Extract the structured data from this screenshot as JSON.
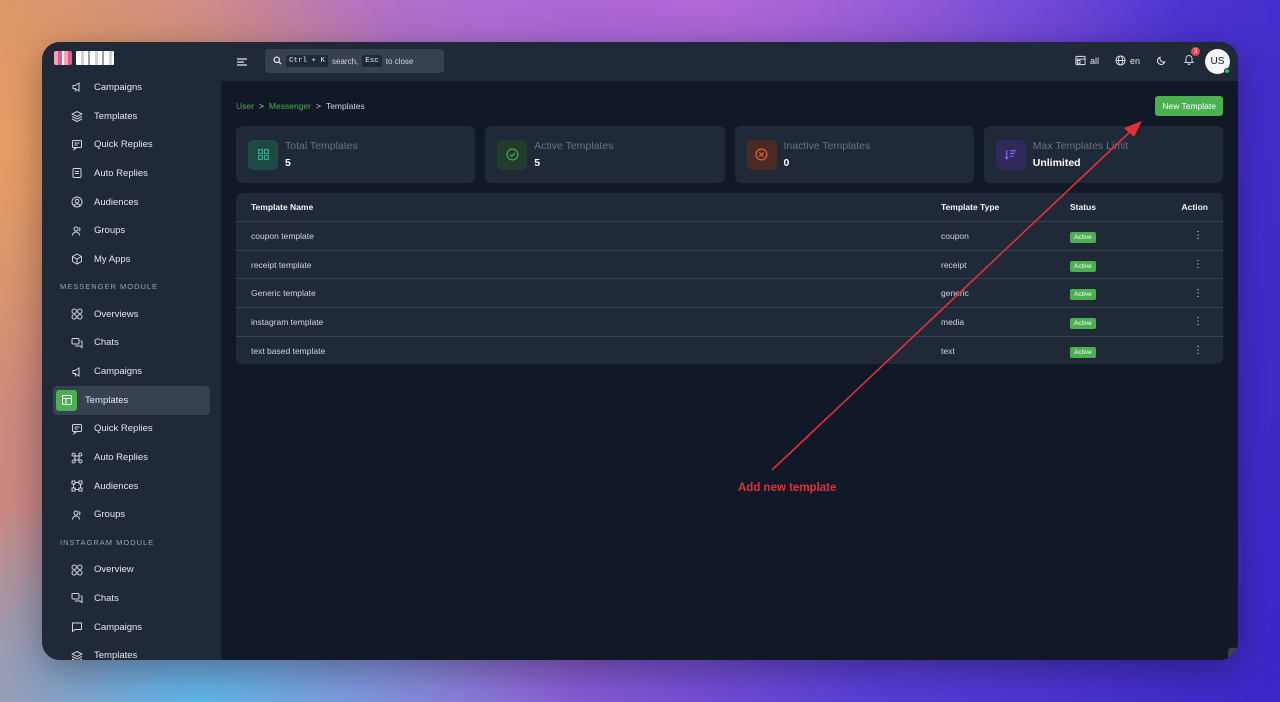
{
  "sidebar": {
    "top_items": [
      {
        "label": "Campaigns",
        "icon": "megaphone-icon"
      },
      {
        "label": "Templates",
        "icon": "layers-icon"
      },
      {
        "label": "Quick Replies",
        "icon": "message-icon"
      },
      {
        "label": "Auto Replies",
        "icon": "file-text-icon"
      },
      {
        "label": "Audiences",
        "icon": "user-circle-icon"
      },
      {
        "label": "Groups",
        "icon": "users-icon"
      },
      {
        "label": "My Apps",
        "icon": "cube-icon"
      }
    ],
    "messenger_section": "MESSENGER MODULE",
    "messenger_items": [
      {
        "label": "Overviews",
        "icon": "grid-circles-icon"
      },
      {
        "label": "Chats",
        "icon": "chats-icon"
      },
      {
        "label": "Campaigns",
        "icon": "megaphone-icon"
      },
      {
        "label": "Templates",
        "icon": "template-icon"
      },
      {
        "label": "Quick Replies",
        "icon": "message-icon"
      },
      {
        "label": "Auto Replies",
        "icon": "command-icon"
      },
      {
        "label": "Audiences",
        "icon": "nodes-icon"
      },
      {
        "label": "Groups",
        "icon": "users-icon"
      }
    ],
    "instagram_section": "INSTAGRAM MODULE",
    "instagram_items": [
      {
        "label": "Overview",
        "icon": "grid-circles-icon"
      },
      {
        "label": "Chats",
        "icon": "chats-icon"
      },
      {
        "label": "Campaigns",
        "icon": "message-square-icon"
      },
      {
        "label": "Templates",
        "icon": "layers-icon"
      }
    ]
  },
  "topbar": {
    "search_kbd_1": "Ctrl + K",
    "search_text_1": "search,",
    "search_kbd_2": "Esc",
    "search_text_2": "to close",
    "workspace": "all",
    "language": "en",
    "notification_count": "3",
    "avatar": "US"
  },
  "breadcrumb": {
    "root": "User",
    "sep": ">",
    "parent": "Messenger",
    "current": "Templates"
  },
  "new_template_button": "New Template",
  "stats": [
    {
      "label": "Total Templates",
      "value": "5",
      "icon": "grid-icon",
      "bg": "#1f4a44",
      "fg": "#3fa88f"
    },
    {
      "label": "Active Templates",
      "value": "5",
      "icon": "check-circle-icon",
      "bg": "#203d2c",
      "fg": "#4caf50"
    },
    {
      "label": "Inactive Templates",
      "value": "0",
      "icon": "x-circle-icon",
      "bg": "#4a2a24",
      "fg": "#e8673a"
    },
    {
      "label": "Max Templates Limit",
      "value": "Unlimited",
      "icon": "list-sort-icon",
      "bg": "#2f2a5a",
      "fg": "#7c6cf0"
    }
  ],
  "table": {
    "headers": {
      "name": "Template Name",
      "type": "Template Type",
      "status": "Status",
      "action": "Action"
    },
    "rows": [
      {
        "name": "coupon template",
        "type": "coupon",
        "status": "Active"
      },
      {
        "name": "receipt template",
        "type": "receipt",
        "status": "Active"
      },
      {
        "name": "Generic template",
        "type": "generic",
        "status": "Active"
      },
      {
        "name": "instagram template",
        "type": "media",
        "status": "Active"
      },
      {
        "name": "text based template",
        "type": "text",
        "status": "Active"
      }
    ]
  },
  "annotation": {
    "text": "Add new template",
    "color": "#e0303a"
  },
  "colors": {
    "accent": "#4caf50",
    "sidebar": "#1f2937",
    "background": "#111827"
  }
}
